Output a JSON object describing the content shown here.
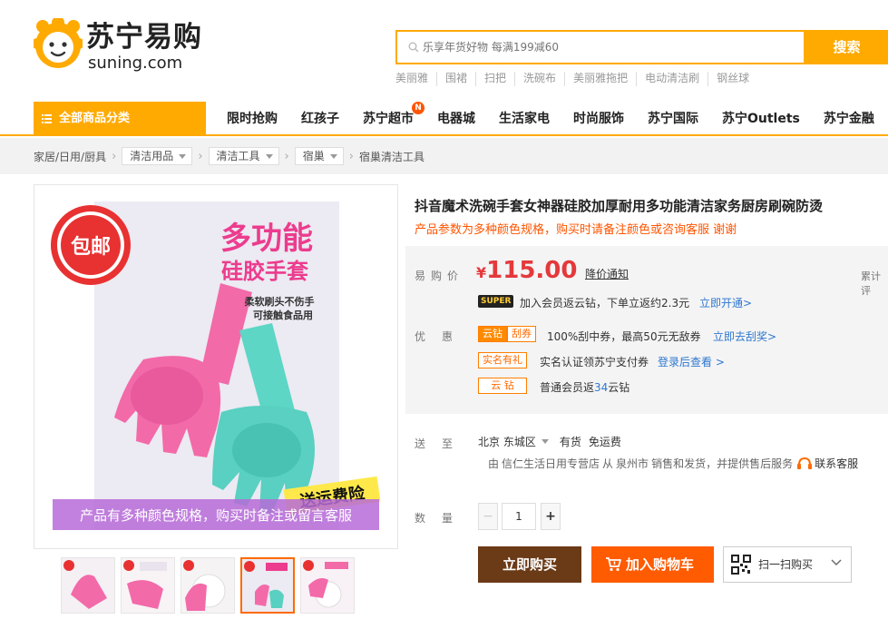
{
  "header": {
    "logo_cn": "苏宁易购",
    "logo_en": "suning.com",
    "search_placeholder": "乐享年货好物 每满199减60",
    "search_button": "搜索",
    "hot_words": [
      "美丽雅",
      "围裙",
      "扫把",
      "洗碗布",
      "美丽雅拖把",
      "电动清洁刷",
      "钢丝球"
    ]
  },
  "nav": {
    "all_categories": "全部商品分类",
    "items": [
      {
        "label": "限时抢购"
      },
      {
        "label": "红孩子"
      },
      {
        "label": "苏宁超市",
        "badge": "N"
      },
      {
        "label": "电器城"
      },
      {
        "label": "生活家电"
      },
      {
        "label": "时尚服饰"
      },
      {
        "label": "苏宁国际"
      },
      {
        "label": "苏宁Outlets"
      },
      {
        "label": "苏宁金融"
      }
    ]
  },
  "breadcrumb": {
    "root": "家居/日用/厨具",
    "levels": [
      "清洁用品",
      "清洁工具",
      "宿巢"
    ],
    "current": "宿巢清洁工具"
  },
  "gallery": {
    "badge": "包邮",
    "headline_1": "多功能",
    "headline_2": "硅胶手套",
    "feature_1": "柔软刷头不伤手",
    "feature_2": "可接触食品用",
    "ship_tag": "送运费险",
    "bottom_note": "产品有多种颜色规格，购买时备注或留言客服",
    "thumbnails": 5,
    "active_thumb": 4
  },
  "product": {
    "title": "抖音魔术洗碗手套女神器硅胶加厚耐用多功能清洁家务厨房刷碗防烫",
    "subtitle": "产品参数为多种颜色规格，购买时请备注颜色或咨询客服 谢谢",
    "price_label": "易购价",
    "currency": "¥",
    "price": "115.00",
    "price_notify": "降价通知",
    "cumulative_review": "累计评",
    "super_tag": "SUPER",
    "super_text": "加入会员返云钻，下单立返约2.3元",
    "super_link": "立即开通>",
    "promo_label": "优惠",
    "promos": {
      "tag_yunzuan": "云钻",
      "tag_guaquan": "刮券",
      "guaquan_text": "100%刮中券，最高50元无敌券",
      "guaquan_link": "立即去刮奖>",
      "tag_realname": "实名有礼",
      "realname_text": "实名认证领苏宁支付券",
      "realname_link": "登录后查看 >",
      "tag_yunzuan2": "云 钻",
      "yunzuan_prefix": "普通会员返",
      "yunzuan_count": "34",
      "yunzuan_suffix": "云钻"
    },
    "delivery_label": "送至",
    "delivery_location": "北京 东城区",
    "stock": "有货",
    "shipping_fee": "免运费",
    "ship_from_prefix": "由",
    "ship_from_store": "信仁生活日用专营店",
    "ship_from_mid": "从",
    "ship_from_city": "泉州市",
    "ship_from_suffix": "销售和发货，并提供售后服务",
    "service_link": "联系客服",
    "qty_label": "数量",
    "qty_minus": "−",
    "qty_value": "1",
    "qty_plus": "+",
    "buy_now": "立即购买",
    "add_to_cart": "加入购物车",
    "scan_buy": "扫一扫购买"
  },
  "colors": {
    "brand_orange": "#ffaa00",
    "price_red": "#e4393c",
    "link_blue": "#2e77d0",
    "buy_brown": "#6b3a16",
    "cart_orange": "#ff5b00"
  }
}
